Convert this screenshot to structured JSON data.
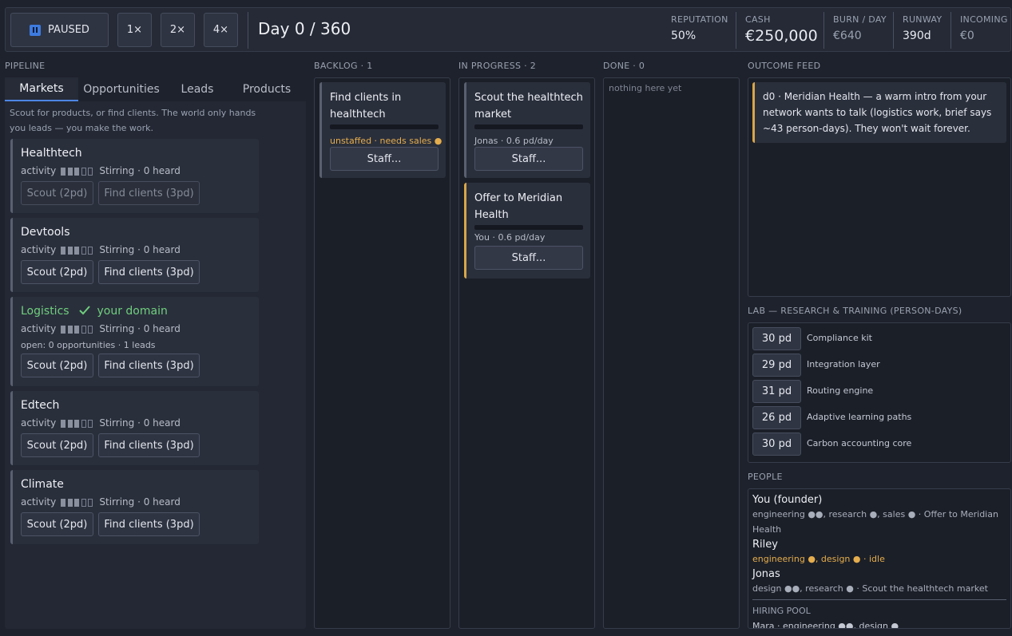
{
  "topbar": {
    "pause_label": "PAUSED",
    "speeds": [
      "1×",
      "2×",
      "4×"
    ],
    "day": "Day 0 / 360",
    "stats": {
      "reputation": {
        "label": "REPUTATION",
        "value": "50%"
      },
      "cash": {
        "label": "CASH",
        "value": "€250,000"
      },
      "burn": {
        "label": "BURN / DAY",
        "value": "€640"
      },
      "runway": {
        "label": "RUNWAY",
        "value": "390d"
      },
      "incoming": {
        "label": "INCOMING",
        "value": "€0"
      }
    }
  },
  "pipeline": {
    "heading": "PIPELINE",
    "tabs": [
      "Markets",
      "Opportunities",
      "Leads",
      "Products"
    ],
    "active_tab": "Markets",
    "hint": "Scout for products, or find clients. The world only hands you leads — you make the work.",
    "activity_label": "activity",
    "markets": [
      {
        "name": "Healthtech",
        "level": 3,
        "status": "Stirring · 0 heard",
        "scout": "Scout (2pd)",
        "find": "Find clients (3pd)",
        "buttons_disabled": true
      },
      {
        "name": "Devtools",
        "level": 3,
        "status": "Stirring · 0 heard",
        "scout": "Scout (2pd)",
        "find": "Find clients (3pd)"
      },
      {
        "name": "Logistics",
        "domain_note": "your domain",
        "level": 3,
        "status": "Stirring · 0 heard",
        "open": "open: 0 opportunities · 1 leads",
        "scout": "Scout (2pd)",
        "find": "Find clients (3pd)"
      },
      {
        "name": "Edtech",
        "level": 3,
        "status": "Stirring · 0 heard",
        "scout": "Scout (2pd)",
        "find": "Find clients (3pd)"
      },
      {
        "name": "Climate",
        "level": 3,
        "status": "Stirring · 0 heard",
        "scout": "Scout (2pd)",
        "find": "Find clients (3pd)"
      }
    ]
  },
  "columns": {
    "backlog": {
      "label": "BACKLOG",
      "count": "1"
    },
    "in_progress": {
      "label": "IN PROGRESS",
      "count": "2"
    },
    "done": {
      "label": "DONE",
      "count": "0",
      "empty_text": "nothing here yet"
    }
  },
  "tasks": {
    "backlog": [
      {
        "title": "Find clients in healthtech",
        "sub": "unstaffed · needs sales ●",
        "progress": 0,
        "staff": "Staff..."
      }
    ],
    "in_progress": [
      {
        "title": "Scout the healthtech market",
        "sub": "Jonas · 0.6 pd/day",
        "progress": 0,
        "staff": "Staff..."
      },
      {
        "title": "Offer to Meridian Health",
        "sub": "You · 0.6 pd/day",
        "progress": 0,
        "staff": "Staff..."
      }
    ]
  },
  "feed": {
    "heading": "OUTCOME FEED",
    "items": [
      "d0 · Meridian Health — a warm intro from your network wants to talk (logistics work, brief says ~43 person-days). They won't wait forever."
    ]
  },
  "lab": {
    "heading": "LAB — RESEARCH & TRAINING (PERSON-DAYS)",
    "items": [
      {
        "pd": "30 pd",
        "name": "Compliance kit"
      },
      {
        "pd": "29 pd",
        "name": "Integration layer"
      },
      {
        "pd": "31 pd",
        "name": "Routing engine"
      },
      {
        "pd": "26 pd",
        "name": "Adaptive learning paths"
      },
      {
        "pd": "30 pd",
        "name": "Carbon accounting core"
      }
    ]
  },
  "people": {
    "heading": "PEOPLE",
    "list": [
      {
        "name": "You (founder)",
        "skills": "engineering ●●, research ●, sales ● · Offer to Meridian Health"
      },
      {
        "name": "Riley",
        "skills": "engineering ●, design ● · idle"
      },
      {
        "name": "Jonas",
        "skills": "design ●●, research ● · Scout the healthtech market"
      }
    ],
    "hiring_pool_label": "HIRING POOL",
    "hiring_preview": "Mara · engineering ●●, design ●"
  },
  "colors": {
    "accent": "#4d86e6",
    "warn": "#e5ad4d",
    "domain": "#6fcf7d",
    "bg": "#1e222c"
  }
}
